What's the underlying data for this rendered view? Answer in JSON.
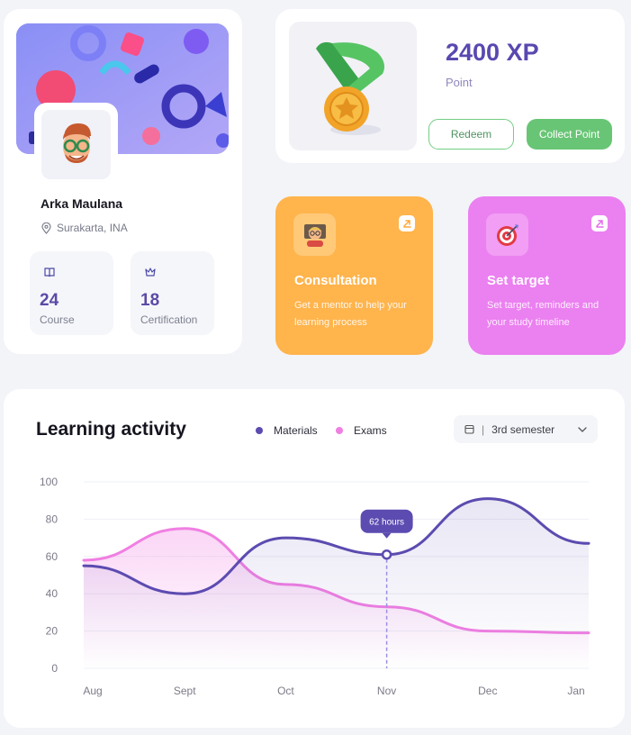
{
  "profile": {
    "name": "Arka Maulana",
    "location": "Surakarta, INA",
    "stats": [
      {
        "value": "24",
        "label": "Course",
        "icon": "book-icon"
      },
      {
        "value": "18",
        "label": "Certification",
        "icon": "crown-icon"
      }
    ]
  },
  "xp": {
    "value": "2400 XP",
    "label": "Point",
    "redeem_label": "Redeem",
    "collect_label": "Collect Point"
  },
  "actions": [
    {
      "title": "Consultation",
      "description": "Get a mentor to help your learning process",
      "icon": "mentor-icon",
      "color": "#ffb44c"
    },
    {
      "title": "Set target",
      "description": "Set target, reminders and your study timeline",
      "icon": "target-icon",
      "color": "#eb80f0"
    }
  ],
  "activity": {
    "title": "Learning activity",
    "legend": [
      {
        "name": "Materials",
        "color": "#5c4bb0"
      },
      {
        "name": "Exams",
        "color": "#f07fe2"
      }
    ],
    "semester": {
      "separator": "|",
      "value": "3rd semester"
    }
  },
  "chart_data": {
    "type": "line",
    "categories": [
      "Aug",
      "Sept",
      "Oct",
      "Nov",
      "Dec",
      "Jan"
    ],
    "ylim": [
      0,
      100
    ],
    "yticks": [
      0,
      20,
      40,
      60,
      80,
      100
    ],
    "series": [
      {
        "name": "Materials",
        "color": "#5c4bb0",
        "values": [
          55,
          40,
          70,
          61,
          91,
          67
        ]
      },
      {
        "name": "Exams",
        "color": "#f07fe2",
        "values": [
          58,
          75,
          45,
          33,
          20,
          19
        ]
      }
    ],
    "tooltip": {
      "text": "62 hours",
      "category": "Nov"
    },
    "grid": true,
    "legend_position": "top"
  }
}
